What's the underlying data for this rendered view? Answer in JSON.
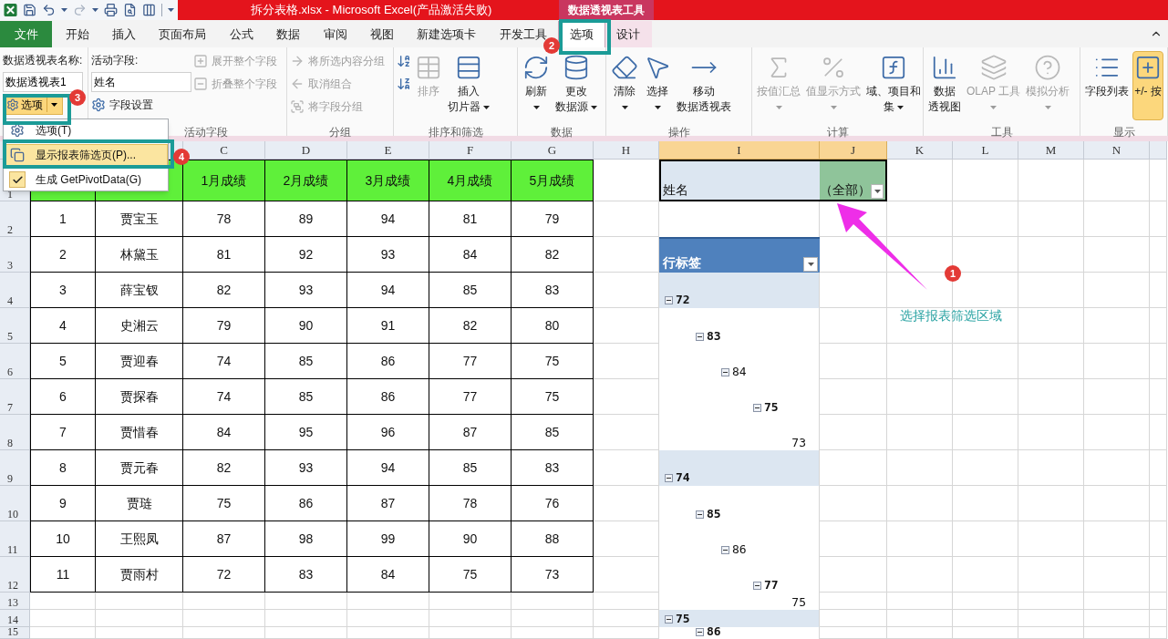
{
  "title_bar": {
    "title": "拆分表格.xlsx  -  Microsoft Excel(产品激活失败)",
    "context_group": "数据透视表工具"
  },
  "tabs": [
    {
      "label": "文件",
      "kind": "file",
      "selected": false
    },
    {
      "label": "开始",
      "kind": "normal",
      "selected": false
    },
    {
      "label": "插入",
      "kind": "normal",
      "selected": false
    },
    {
      "label": "页面布局",
      "kind": "normal",
      "selected": false
    },
    {
      "label": "公式",
      "kind": "normal",
      "selected": false
    },
    {
      "label": "数据",
      "kind": "normal",
      "selected": false
    },
    {
      "label": "审阅",
      "kind": "normal",
      "selected": false
    },
    {
      "label": "视图",
      "kind": "normal",
      "selected": false
    },
    {
      "label": "新建选项卡",
      "kind": "normal",
      "selected": false
    },
    {
      "label": "开发工具",
      "kind": "normal",
      "selected": false
    },
    {
      "label": "选项",
      "kind": "context",
      "selected": true
    },
    {
      "label": "设计",
      "kind": "context",
      "selected": false
    }
  ],
  "ribbon": {
    "groups": [
      {
        "columns": [
          {
            "kind": "stack",
            "items": [
              {
                "kind": "label",
                "text": "数据透视表名称:"
              },
              {
                "kind": "field",
                "value": "数据透视表1"
              },
              {
                "kind": "split",
                "text": "选项",
                "active": true
              }
            ]
          }
        ]
      },
      {
        "label": "活动字段",
        "columns": [
          {
            "kind": "stack",
            "items": [
              {
                "kind": "label",
                "text": "活动字段:"
              },
              {
                "kind": "field",
                "value": "姓名"
              },
              {
                "kind": "button",
                "text": "字段设置",
                "disabled": false
              }
            ]
          },
          {
            "kind": "stack",
            "items": [
              {
                "kind": "button",
                "text": "展开整个字段",
                "disabled": true
              },
              {
                "kind": "button",
                "text": "折叠整个字段",
                "disabled": true
              }
            ]
          }
        ]
      },
      {
        "label": "分组",
        "columns": [
          {
            "kind": "stack",
            "items": [
              {
                "kind": "button",
                "text": "将所选内容分组",
                "disabled": true
              },
              {
                "kind": "button",
                "text": "取消组合",
                "disabled": true
              },
              {
                "kind": "button",
                "text": "将字段分组",
                "disabled": true
              }
            ]
          }
        ]
      },
      {
        "label": "排序和筛选",
        "columns": [
          {
            "kind": "stack",
            "items": [
              {
                "kind": "icon-button",
                "disabled": false
              },
              {
                "kind": "icon-button",
                "disabled": false
              }
            ]
          },
          {
            "kind": "large",
            "lines": [
              "排序"
            ],
            "dropdown": false,
            "disabled": true,
            "active": false
          },
          {
            "kind": "large",
            "lines": [
              "插入",
              "切片器"
            ],
            "dropdown": true,
            "disabled": false,
            "active": false
          }
        ]
      },
      {
        "label": "数据",
        "columns": [
          {
            "kind": "large",
            "lines": [
              "刷新"
            ],
            "dropdown": true,
            "disabled": false,
            "active": false
          },
          {
            "kind": "large",
            "lines": [
              "更改",
              "数据源"
            ],
            "dropdown": true,
            "disabled": false,
            "active": false
          }
        ]
      },
      {
        "label": "操作",
        "columns": [
          {
            "kind": "large",
            "lines": [
              "清除"
            ],
            "dropdown": true,
            "disabled": false,
            "active": false
          },
          {
            "kind": "large",
            "lines": [
              "选择"
            ],
            "dropdown": true,
            "disabled": false,
            "active": false
          },
          {
            "kind": "large",
            "lines": [
              "移动",
              "数据透视表"
            ],
            "dropdown": false,
            "disabled": false,
            "active": false
          }
        ]
      },
      {
        "label": "计算",
        "columns": [
          {
            "kind": "large",
            "lines": [
              "按值汇总"
            ],
            "dropdown": true,
            "disabled": true,
            "active": false
          },
          {
            "kind": "large",
            "lines": [
              "值显示方式"
            ],
            "dropdown": true,
            "disabled": true,
            "active": false
          },
          {
            "kind": "large",
            "lines": [
              "域、项目和",
              "集"
            ],
            "dropdown": true,
            "disabled": false,
            "active": false
          }
        ]
      },
      {
        "label": "工具",
        "columns": [
          {
            "kind": "large",
            "lines": [
              "数据",
              "透视图"
            ],
            "dropdown": false,
            "disabled": false,
            "active": false
          },
          {
            "kind": "large",
            "lines": [
              "OLAP 工具"
            ],
            "dropdown": true,
            "disabled": true,
            "active": false
          },
          {
            "kind": "large",
            "lines": [
              "模拟分析"
            ],
            "dropdown": true,
            "disabled": true,
            "active": false
          }
        ]
      },
      {
        "label": "显示",
        "columns": [
          {
            "kind": "large",
            "lines": [
              "字段列表"
            ],
            "dropdown": false,
            "disabled": false,
            "active": false
          },
          {
            "kind": "large",
            "lines": [
              "+/- 按"
            ],
            "dropdown": false,
            "disabled": false,
            "active": true
          }
        ]
      }
    ]
  },
  "menu": {
    "items": [
      {
        "text": "选项(T)",
        "selected": false,
        "checked": false
      },
      {
        "text": "显示报表筛选页(P)...",
        "selected": true,
        "checked": false
      },
      {
        "text": "生成 GetPivotData(G)",
        "selected": false,
        "checked": true
      }
    ]
  },
  "sheet": {
    "column_headers": [
      {
        "label": "C",
        "selected": false
      },
      {
        "label": "D",
        "selected": false
      },
      {
        "label": "E",
        "selected": false
      },
      {
        "label": "F",
        "selected": false
      },
      {
        "label": "G",
        "selected": false
      },
      {
        "label": "H",
        "selected": false
      },
      {
        "label": "I",
        "selected": true
      },
      {
        "label": "J",
        "selected": true
      },
      {
        "label": "K",
        "selected": false
      },
      {
        "label": "L",
        "selected": false
      },
      {
        "label": "M",
        "selected": false
      },
      {
        "label": "N",
        "selected": false
      }
    ],
    "row_numbers": [
      "1",
      "2",
      "3",
      "4",
      "5",
      "6",
      "7",
      "8",
      "9",
      "10",
      "11",
      "12",
      "13",
      "14",
      "15"
    ]
  },
  "data_table": {
    "columns": [
      "",
      "",
      "1月成绩",
      "2月成绩",
      "3月成绩",
      "4月成绩",
      "5月成绩"
    ],
    "rows": [
      {
        "cells": [
          "1",
          "贾宝玉",
          "78",
          "89",
          "94",
          "81",
          "79"
        ]
      },
      {
        "cells": [
          "2",
          "林黛玉",
          "81",
          "92",
          "93",
          "84",
          "82"
        ]
      },
      {
        "cells": [
          "3",
          "薛宝钗",
          "82",
          "93",
          "94",
          "85",
          "83"
        ]
      },
      {
        "cells": [
          "4",
          "史湘云",
          "79",
          "90",
          "91",
          "82",
          "80"
        ]
      },
      {
        "cells": [
          "5",
          "贾迎春",
          "74",
          "85",
          "86",
          "77",
          "75"
        ]
      },
      {
        "cells": [
          "6",
          "贾探春",
          "74",
          "85",
          "86",
          "77",
          "75"
        ]
      },
      {
        "cells": [
          "7",
          "贾惜春",
          "84",
          "95",
          "96",
          "87",
          "85"
        ]
      },
      {
        "cells": [
          "8",
          "贾元春",
          "82",
          "93",
          "94",
          "85",
          "83"
        ]
      },
      {
        "cells": [
          "9",
          "贾琏",
          "75",
          "86",
          "87",
          "78",
          "76"
        ]
      },
      {
        "cells": [
          "10",
          "王熙凤",
          "87",
          "98",
          "99",
          "90",
          "88"
        ]
      },
      {
        "cells": [
          "11",
          "贾雨村",
          "72",
          "83",
          "84",
          "75",
          "73"
        ]
      }
    ]
  },
  "pivot": {
    "filter": {
      "field": "姓名",
      "value": "（全部）"
    },
    "row_header": "行标签",
    "rows": [
      {
        "label": "72",
        "expanded": true,
        "children": [
          {
            "label": "83",
            "expanded": true,
            "children": [
              {
                "label": "84",
                "expanded": true,
                "children": [
                  {
                    "label": "75",
                    "expanded": true,
                    "children": [
                      {
                        "label": "73"
                      }
                    ]
                  }
                ]
              }
            ]
          }
        ]
      },
      {
        "label": "74",
        "expanded": true,
        "children": [
          {
            "label": "85",
            "expanded": true,
            "children": [
              {
                "label": "86",
                "expanded": true,
                "children": [
                  {
                    "label": "77",
                    "expanded": true,
                    "children": [
                      {
                        "label": "75"
                      }
                    ]
                  }
                ]
              }
            ]
          }
        ]
      },
      {
        "label": "75",
        "expanded": true,
        "children": [
          {
            "label": "86",
            "expanded": true
          }
        ]
      }
    ]
  },
  "annotations": {
    "badges": [
      "1",
      "2",
      "3",
      "4"
    ],
    "callout": "选择报表筛选区域"
  }
}
